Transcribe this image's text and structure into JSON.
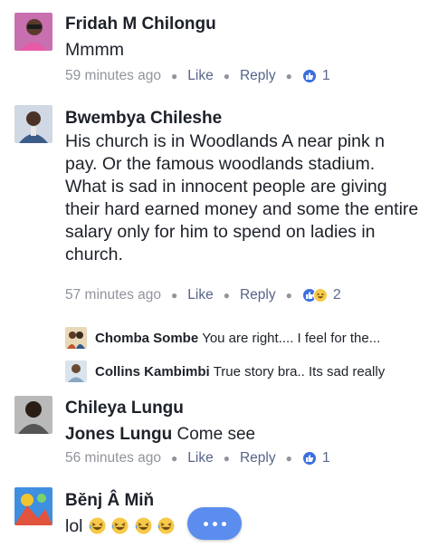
{
  "comments": [
    {
      "author": "Fridah M Chilongu",
      "text": "Mmmm",
      "time": "59 minutes ago",
      "like_label": "Like",
      "reply_label": "Reply",
      "reaction_count": "1"
    },
    {
      "author": "Bwembya Chileshe",
      "text": "His church is in Woodlands A near pink n pay. Or the famous woodlands stadium. What is sad in innocent people are giving their hard earned money and some the entire salary only for him to spend on ladies in church.",
      "time": "57 minutes ago",
      "like_label": "Like",
      "reply_label": "Reply",
      "reaction_count": "2",
      "replies": [
        {
          "author": "Chomba Sombe",
          "text": "You are right.... I feel for the..."
        },
        {
          "author": "Collins Kambimbi",
          "text": "True story bra.. Its sad really"
        }
      ]
    },
    {
      "author": "Chileya Lungu",
      "tagged": "Jones Lungu",
      "text": "Come see",
      "time": "56 minutes ago",
      "like_label": "Like",
      "reply_label": "Reply",
      "reaction_count": "1"
    },
    {
      "author": "Bĕnj Â Miň",
      "text": "lol"
    }
  ],
  "icons": {
    "like": "like-icon",
    "haha": "haha-icon",
    "more": "more-options-icon"
  },
  "colors": {
    "like_blue": "#3b6fe0",
    "fab_blue": "#5b8def",
    "meta_gray": "#90949c"
  }
}
